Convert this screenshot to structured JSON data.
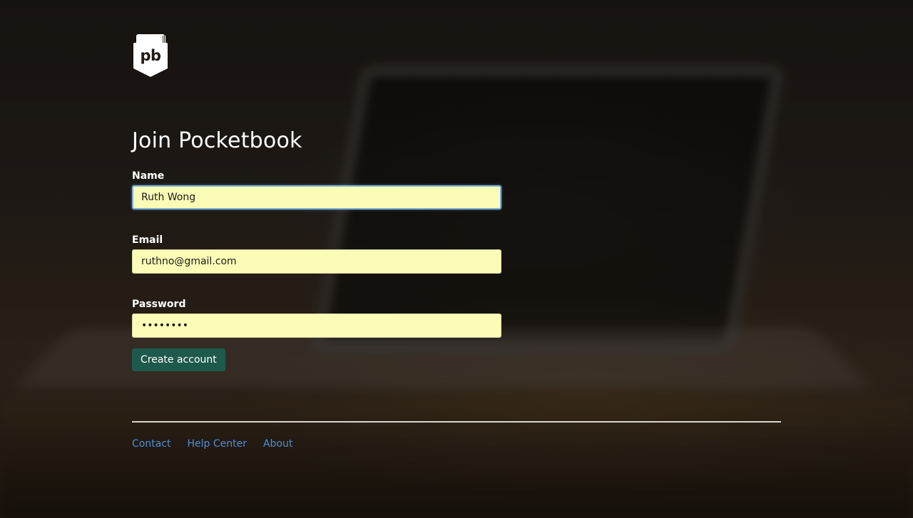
{
  "brand": {
    "logo_text": "pb",
    "logo_icon": "pocketbook-logo-icon"
  },
  "page": {
    "title": "Join Pocketbook"
  },
  "form": {
    "name": {
      "label": "Name",
      "value": "Ruth Wong"
    },
    "email": {
      "label": "Email",
      "value": "ruthno@gmail.com"
    },
    "password": {
      "label": "Password",
      "value": "password"
    },
    "submit_label": "Create account"
  },
  "footer": {
    "links": [
      "Contact",
      "Help Center",
      "About"
    ]
  },
  "colors": {
    "input_bg": "#fbfdb6",
    "button_bg": "#1e5a4b",
    "link": "#4f8fd6"
  }
}
